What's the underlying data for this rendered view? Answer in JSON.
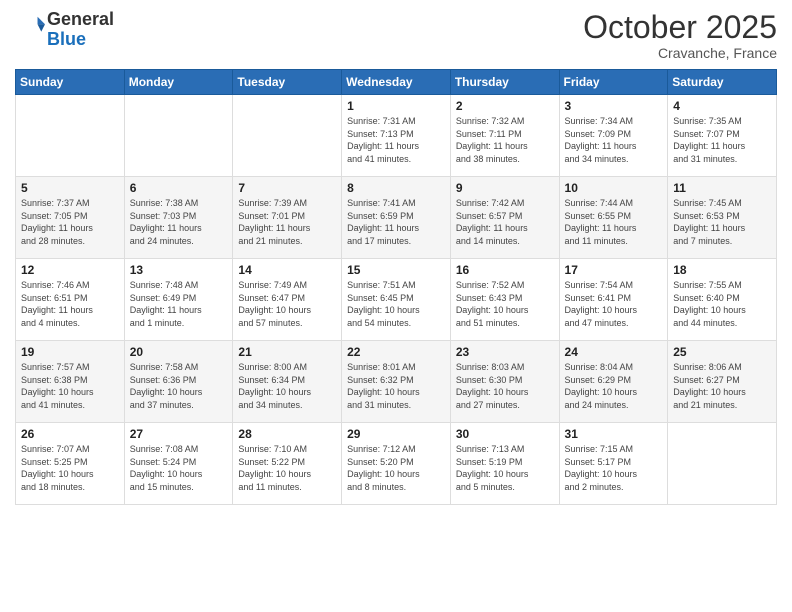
{
  "logo": {
    "line1": "General",
    "line2": "Blue"
  },
  "title": "October 2025",
  "subtitle": "Cravanche, France",
  "headers": [
    "Sunday",
    "Monday",
    "Tuesday",
    "Wednesday",
    "Thursday",
    "Friday",
    "Saturday"
  ],
  "weeks": [
    [
      {
        "day": "",
        "info": ""
      },
      {
        "day": "",
        "info": ""
      },
      {
        "day": "",
        "info": ""
      },
      {
        "day": "1",
        "info": "Sunrise: 7:31 AM\nSunset: 7:13 PM\nDaylight: 11 hours\nand 41 minutes."
      },
      {
        "day": "2",
        "info": "Sunrise: 7:32 AM\nSunset: 7:11 PM\nDaylight: 11 hours\nand 38 minutes."
      },
      {
        "day": "3",
        "info": "Sunrise: 7:34 AM\nSunset: 7:09 PM\nDaylight: 11 hours\nand 34 minutes."
      },
      {
        "day": "4",
        "info": "Sunrise: 7:35 AM\nSunset: 7:07 PM\nDaylight: 11 hours\nand 31 minutes."
      }
    ],
    [
      {
        "day": "5",
        "info": "Sunrise: 7:37 AM\nSunset: 7:05 PM\nDaylight: 11 hours\nand 28 minutes."
      },
      {
        "day": "6",
        "info": "Sunrise: 7:38 AM\nSunset: 7:03 PM\nDaylight: 11 hours\nand 24 minutes."
      },
      {
        "day": "7",
        "info": "Sunrise: 7:39 AM\nSunset: 7:01 PM\nDaylight: 11 hours\nand 21 minutes."
      },
      {
        "day": "8",
        "info": "Sunrise: 7:41 AM\nSunset: 6:59 PM\nDaylight: 11 hours\nand 17 minutes."
      },
      {
        "day": "9",
        "info": "Sunrise: 7:42 AM\nSunset: 6:57 PM\nDaylight: 11 hours\nand 14 minutes."
      },
      {
        "day": "10",
        "info": "Sunrise: 7:44 AM\nSunset: 6:55 PM\nDaylight: 11 hours\nand 11 minutes."
      },
      {
        "day": "11",
        "info": "Sunrise: 7:45 AM\nSunset: 6:53 PM\nDaylight: 11 hours\nand 7 minutes."
      }
    ],
    [
      {
        "day": "12",
        "info": "Sunrise: 7:46 AM\nSunset: 6:51 PM\nDaylight: 11 hours\nand 4 minutes."
      },
      {
        "day": "13",
        "info": "Sunrise: 7:48 AM\nSunset: 6:49 PM\nDaylight: 11 hours\nand 1 minute."
      },
      {
        "day": "14",
        "info": "Sunrise: 7:49 AM\nSunset: 6:47 PM\nDaylight: 10 hours\nand 57 minutes."
      },
      {
        "day": "15",
        "info": "Sunrise: 7:51 AM\nSunset: 6:45 PM\nDaylight: 10 hours\nand 54 minutes."
      },
      {
        "day": "16",
        "info": "Sunrise: 7:52 AM\nSunset: 6:43 PM\nDaylight: 10 hours\nand 51 minutes."
      },
      {
        "day": "17",
        "info": "Sunrise: 7:54 AM\nSunset: 6:41 PM\nDaylight: 10 hours\nand 47 minutes."
      },
      {
        "day": "18",
        "info": "Sunrise: 7:55 AM\nSunset: 6:40 PM\nDaylight: 10 hours\nand 44 minutes."
      }
    ],
    [
      {
        "day": "19",
        "info": "Sunrise: 7:57 AM\nSunset: 6:38 PM\nDaylight: 10 hours\nand 41 minutes."
      },
      {
        "day": "20",
        "info": "Sunrise: 7:58 AM\nSunset: 6:36 PM\nDaylight: 10 hours\nand 37 minutes."
      },
      {
        "day": "21",
        "info": "Sunrise: 8:00 AM\nSunset: 6:34 PM\nDaylight: 10 hours\nand 34 minutes."
      },
      {
        "day": "22",
        "info": "Sunrise: 8:01 AM\nSunset: 6:32 PM\nDaylight: 10 hours\nand 31 minutes."
      },
      {
        "day": "23",
        "info": "Sunrise: 8:03 AM\nSunset: 6:30 PM\nDaylight: 10 hours\nand 27 minutes."
      },
      {
        "day": "24",
        "info": "Sunrise: 8:04 AM\nSunset: 6:29 PM\nDaylight: 10 hours\nand 24 minutes."
      },
      {
        "day": "25",
        "info": "Sunrise: 8:06 AM\nSunset: 6:27 PM\nDaylight: 10 hours\nand 21 minutes."
      }
    ],
    [
      {
        "day": "26",
        "info": "Sunrise: 7:07 AM\nSunset: 5:25 PM\nDaylight: 10 hours\nand 18 minutes."
      },
      {
        "day": "27",
        "info": "Sunrise: 7:08 AM\nSunset: 5:24 PM\nDaylight: 10 hours\nand 15 minutes."
      },
      {
        "day": "28",
        "info": "Sunrise: 7:10 AM\nSunset: 5:22 PM\nDaylight: 10 hours\nand 11 minutes."
      },
      {
        "day": "29",
        "info": "Sunrise: 7:12 AM\nSunset: 5:20 PM\nDaylight: 10 hours\nand 8 minutes."
      },
      {
        "day": "30",
        "info": "Sunrise: 7:13 AM\nSunset: 5:19 PM\nDaylight: 10 hours\nand 5 minutes."
      },
      {
        "day": "31",
        "info": "Sunrise: 7:15 AM\nSunset: 5:17 PM\nDaylight: 10 hours\nand 2 minutes."
      },
      {
        "day": "",
        "info": ""
      }
    ]
  ]
}
